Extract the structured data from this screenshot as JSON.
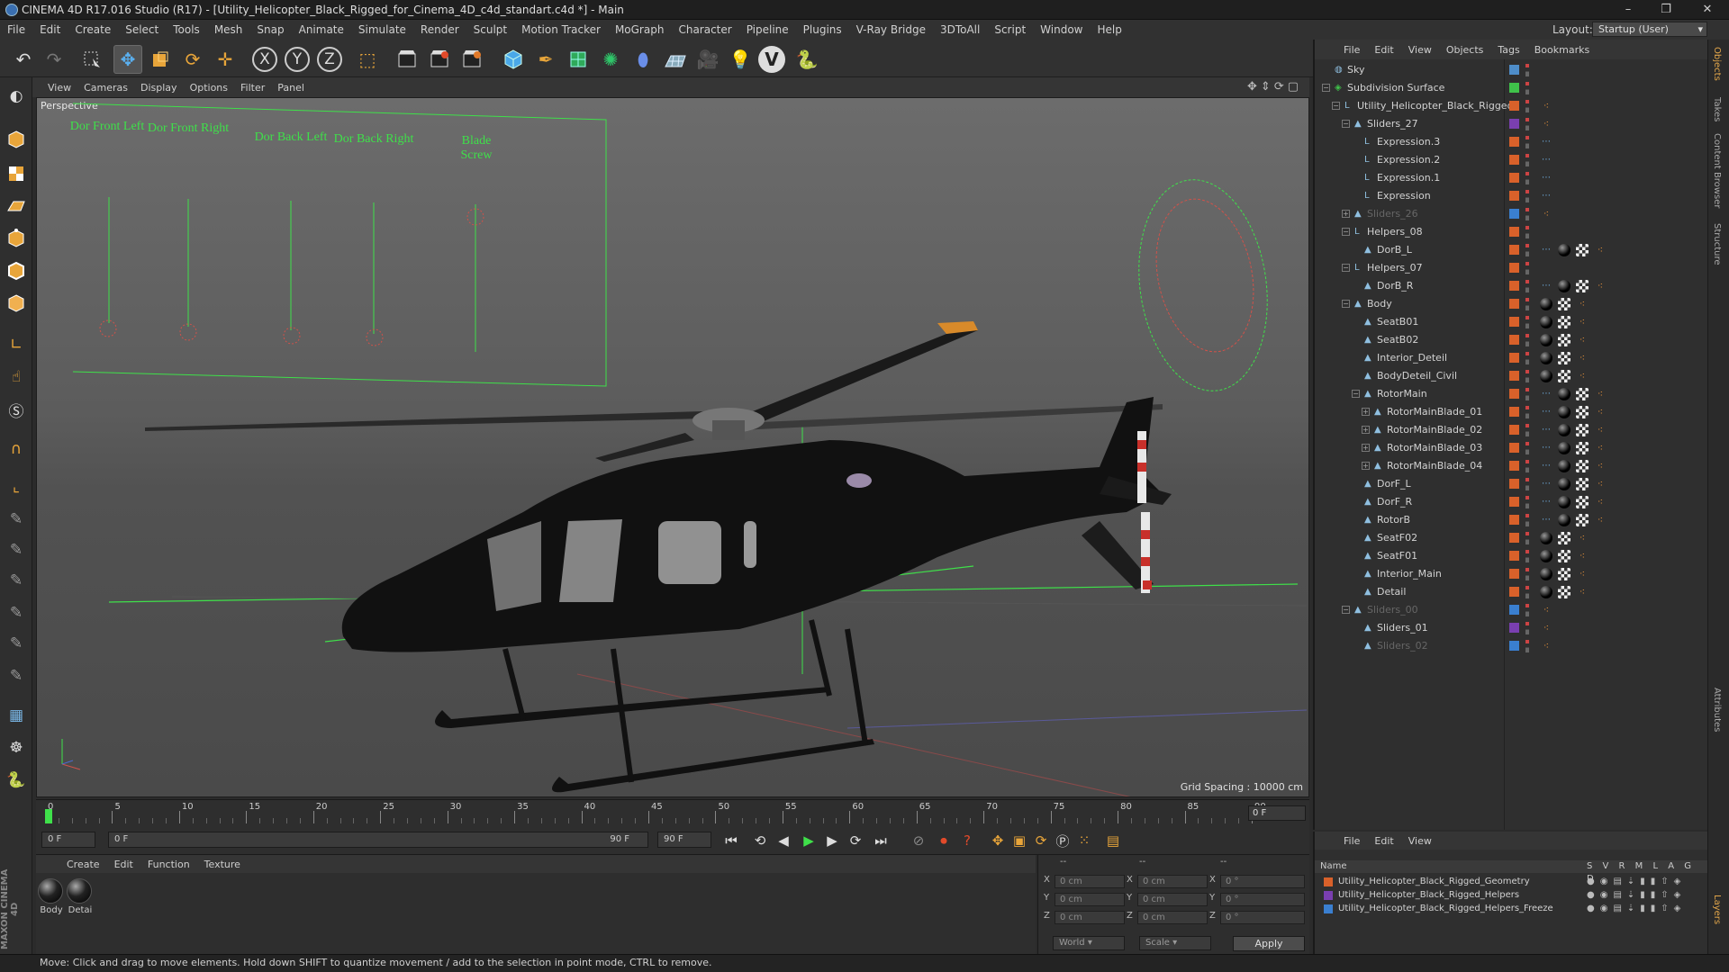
{
  "window": {
    "title": "CINEMA 4D R17.016 Studio (R17) - [Utility_Helicopter_Black_Rigged_for_Cinema_4D_c4d_standart.c4d *] - Main",
    "controls": [
      "–",
      "❐",
      "✕"
    ]
  },
  "menubar": {
    "items": [
      "File",
      "Edit",
      "Create",
      "Select",
      "Tools",
      "Mesh",
      "Snap",
      "Animate",
      "Simulate",
      "Render",
      "Sculpt",
      "Motion Tracker",
      "MoGraph",
      "Character",
      "Pipeline",
      "Plugins",
      "V-Ray Bridge",
      "3DToAll",
      "Script",
      "Window",
      "Help"
    ],
    "layout_label": "Layout:",
    "layout_value": "Startup (User)"
  },
  "toolbar": {
    "icons": [
      "undo-icon",
      "redo-icon",
      "live-selection-icon",
      "move-icon",
      "scale-icon",
      "rotate-icon",
      "move-axis-icon",
      "x-axis-icon",
      "y-axis-icon",
      "z-axis-icon",
      "coordinate-system-icon",
      "render-view-icon",
      "render-picture-viewer-icon",
      "edit-render-settings-icon",
      "cube-icon",
      "pen-spline-icon",
      "subdivision-icon",
      "cloner-icon",
      "deformer-icon",
      "floor-icon",
      "camera-icon",
      "light-icon",
      "vray-icon",
      "python-icon"
    ],
    "axis_labels": [
      "X",
      "Y",
      "Z"
    ]
  },
  "viewport": {
    "menu": [
      "View",
      "Cameras",
      "Display",
      "Options",
      "Filter",
      "Panel"
    ],
    "label": "Perspective",
    "grid_spacing": "Grid Spacing : 10000 cm",
    "sliders": [
      "Dor Front Left",
      "Dor Front Right",
      "Dor Back Left",
      "Dor Back Right",
      "Blade Screw"
    ],
    "accent_green": "#3fe04a"
  },
  "timeline": {
    "ticks": [
      "0",
      "5",
      "10",
      "15",
      "20",
      "25",
      "30",
      "35",
      "40",
      "45",
      "50",
      "55",
      "60",
      "65",
      "70",
      "75",
      "80",
      "85",
      "90"
    ],
    "end_frame_box": "0 F",
    "current_frame": "0 F",
    "range_start": "0 F",
    "range_end": "90 F",
    "max_frame": "90 F",
    "preview_end": "90 F"
  },
  "materials": {
    "menu": [
      "Create",
      "Edit",
      "Function",
      "Texture"
    ],
    "items": [
      {
        "label": "Body"
      },
      {
        "label": "Detai"
      }
    ]
  },
  "coordinates": {
    "header": [
      "--",
      "--",
      "--"
    ],
    "rows": [
      {
        "axis": "X",
        "pos": "0 cm",
        "size_axis": "X",
        "size": "0 cm",
        "rot_axis": "X",
        "rot": "0 °"
      },
      {
        "axis": "Y",
        "pos": "0 cm",
        "size_axis": "Y",
        "size": "0 cm",
        "rot_axis": "Y",
        "rot": "0 °"
      },
      {
        "axis": "Z",
        "pos": "0 cm",
        "size_axis": "Z",
        "size": "0 cm",
        "rot_axis": "Z",
        "rot": "0 °"
      }
    ],
    "mode": "World",
    "transform": "Scale",
    "apply": "Apply"
  },
  "objects": {
    "menu": [
      "File",
      "Edit",
      "View",
      "Objects",
      "Tags",
      "Bookmarks"
    ],
    "tree": [
      {
        "name": "Sky",
        "indent": 0,
        "expand": "",
        "icon": "sky",
        "color": "#4e8dc9",
        "tags": []
      },
      {
        "name": "Subdivision Surface",
        "indent": 0,
        "expand": "−",
        "icon": "subd",
        "color": "#3fc24a",
        "tags": []
      },
      {
        "name": "Utility_Helicopter_Black_Rigged",
        "indent": 1,
        "expand": "−",
        "icon": "null",
        "color": "#d9612a",
        "tags": [
          "ph"
        ]
      },
      {
        "name": "Sliders_27",
        "indent": 2,
        "expand": "−",
        "icon": "poly",
        "color": "#7a3fb0",
        "tags": [
          "ph"
        ]
      },
      {
        "name": "Expression.3",
        "indent": 3,
        "expand": "",
        "icon": "null",
        "color": "#d9612a",
        "tags": [
          "ex"
        ]
      },
      {
        "name": "Expression.2",
        "indent": 3,
        "expand": "",
        "icon": "null",
        "color": "#d9612a",
        "tags": [
          "ex"
        ]
      },
      {
        "name": "Expression.1",
        "indent": 3,
        "expand": "",
        "icon": "null",
        "color": "#d9612a",
        "tags": [
          "ex"
        ]
      },
      {
        "name": "Expression",
        "indent": 3,
        "expand": "",
        "icon": "null",
        "color": "#d9612a",
        "tags": [
          "ex"
        ]
      },
      {
        "name": "Sliders_26",
        "indent": 2,
        "expand": "+",
        "icon": "poly",
        "color": "#3a7fd0",
        "tags": [
          "ph"
        ],
        "dim": true
      },
      {
        "name": "Helpers_08",
        "indent": 2,
        "expand": "−",
        "icon": "null",
        "color": "#d9612a",
        "tags": []
      },
      {
        "name": "DorB_L",
        "indent": 3,
        "expand": "",
        "icon": "poly",
        "color": "#d9612a",
        "tags": [
          "ex",
          "ball",
          "chk",
          "ph"
        ]
      },
      {
        "name": "Helpers_07",
        "indent": 2,
        "expand": "−",
        "icon": "null",
        "color": "#d9612a",
        "tags": []
      },
      {
        "name": "DorB_R",
        "indent": 3,
        "expand": "",
        "icon": "poly",
        "color": "#d9612a",
        "tags": [
          "ex",
          "ball",
          "chk",
          "ph"
        ]
      },
      {
        "name": "Body",
        "indent": 2,
        "expand": "−",
        "icon": "poly",
        "color": "#d9612a",
        "tags": [
          "ball",
          "chk",
          "ph"
        ]
      },
      {
        "name": "SeatB01",
        "indent": 3,
        "expand": "",
        "icon": "poly",
        "color": "#d9612a",
        "tags": [
          "ball",
          "chk",
          "ph"
        ]
      },
      {
        "name": "SeatB02",
        "indent": 3,
        "expand": "",
        "icon": "poly",
        "color": "#d9612a",
        "tags": [
          "ball",
          "chk",
          "ph"
        ]
      },
      {
        "name": "Interior_Deteil",
        "indent": 3,
        "expand": "",
        "icon": "poly",
        "color": "#d9612a",
        "tags": [
          "ball",
          "chk",
          "ph"
        ]
      },
      {
        "name": "BodyDeteil_Civil",
        "indent": 3,
        "expand": "",
        "icon": "poly",
        "color": "#d9612a",
        "tags": [
          "ball",
          "chk",
          "ph"
        ]
      },
      {
        "name": "RotorMain",
        "indent": 3,
        "expand": "−",
        "icon": "poly",
        "color": "#d9612a",
        "tags": [
          "ex",
          "ball",
          "chk",
          "ph"
        ]
      },
      {
        "name": "RotorMainBlade_01",
        "indent": 4,
        "expand": "+",
        "icon": "poly",
        "color": "#d9612a",
        "tags": [
          "ex",
          "ball",
          "chk",
          "ph"
        ]
      },
      {
        "name": "RotorMainBlade_02",
        "indent": 4,
        "expand": "+",
        "icon": "poly",
        "color": "#d9612a",
        "tags": [
          "ex",
          "ball",
          "chk",
          "ph"
        ]
      },
      {
        "name": "RotorMainBlade_03",
        "indent": 4,
        "expand": "+",
        "icon": "poly",
        "color": "#d9612a",
        "tags": [
          "ex",
          "ball",
          "chk",
          "ph"
        ]
      },
      {
        "name": "RotorMainBlade_04",
        "indent": 4,
        "expand": "+",
        "icon": "poly",
        "color": "#d9612a",
        "tags": [
          "ex",
          "ball",
          "chk",
          "ph"
        ]
      },
      {
        "name": "DorF_L",
        "indent": 3,
        "expand": "",
        "icon": "poly",
        "color": "#d9612a",
        "tags": [
          "ex",
          "ball",
          "chk",
          "ph"
        ]
      },
      {
        "name": "DorF_R",
        "indent": 3,
        "expand": "",
        "icon": "poly",
        "color": "#d9612a",
        "tags": [
          "ex",
          "ball",
          "chk",
          "ph"
        ]
      },
      {
        "name": "RotorB",
        "indent": 3,
        "expand": "",
        "icon": "poly",
        "color": "#d9612a",
        "tags": [
          "ex",
          "ball",
          "chk",
          "ph"
        ]
      },
      {
        "name": "SeatF02",
        "indent": 3,
        "expand": "",
        "icon": "poly",
        "color": "#d9612a",
        "tags": [
          "ball",
          "chk",
          "ph"
        ]
      },
      {
        "name": "SeatF01",
        "indent": 3,
        "expand": "",
        "icon": "poly",
        "color": "#d9612a",
        "tags": [
          "ball",
          "chk",
          "ph"
        ]
      },
      {
        "name": "Interior_Main",
        "indent": 3,
        "expand": "",
        "icon": "poly",
        "color": "#d9612a",
        "tags": [
          "ball",
          "chk",
          "ph"
        ]
      },
      {
        "name": "Detail",
        "indent": 3,
        "expand": "",
        "icon": "poly",
        "color": "#d9612a",
        "tags": [
          "ball",
          "chk",
          "ph"
        ]
      },
      {
        "name": "Sliders_00",
        "indent": 2,
        "expand": "−",
        "icon": "poly",
        "color": "#3a7fd0",
        "tags": [
          "ph"
        ],
        "dim": true
      },
      {
        "name": "Sliders_01",
        "indent": 3,
        "expand": "",
        "icon": "poly",
        "color": "#7a3fb0",
        "tags": [
          "ph"
        ]
      },
      {
        "name": "Sliders_02",
        "indent": 3,
        "expand": "",
        "icon": "poly",
        "color": "#3a7fd0",
        "tags": [
          "ph"
        ],
        "dim": true
      }
    ]
  },
  "layers": {
    "menu": [
      "File",
      "Edit",
      "View"
    ],
    "header": {
      "name": "Name",
      "flags": "S V R M L A G D"
    },
    "items": [
      {
        "name": "Utility_Helicopter_Black_Rigged_Geometry",
        "color": "#d9612a"
      },
      {
        "name": "Utility_Helicopter_Black_Rigged_Helpers",
        "color": "#7a3fb0"
      },
      {
        "name": "Utility_Helicopter_Black_Rigged_Helpers_Freeze",
        "color": "#3a7fd0"
      }
    ]
  },
  "right_tabs": [
    "Objects",
    "Takes",
    "Content Browser",
    "Structure",
    "Attributes",
    "Layers"
  ],
  "status": "Move: Click and drag to move elements. Hold down SHIFT to quantize movement / add to the selection in point mode, CTRL to remove.",
  "maxon": "MAXON CINEMA 4D"
}
